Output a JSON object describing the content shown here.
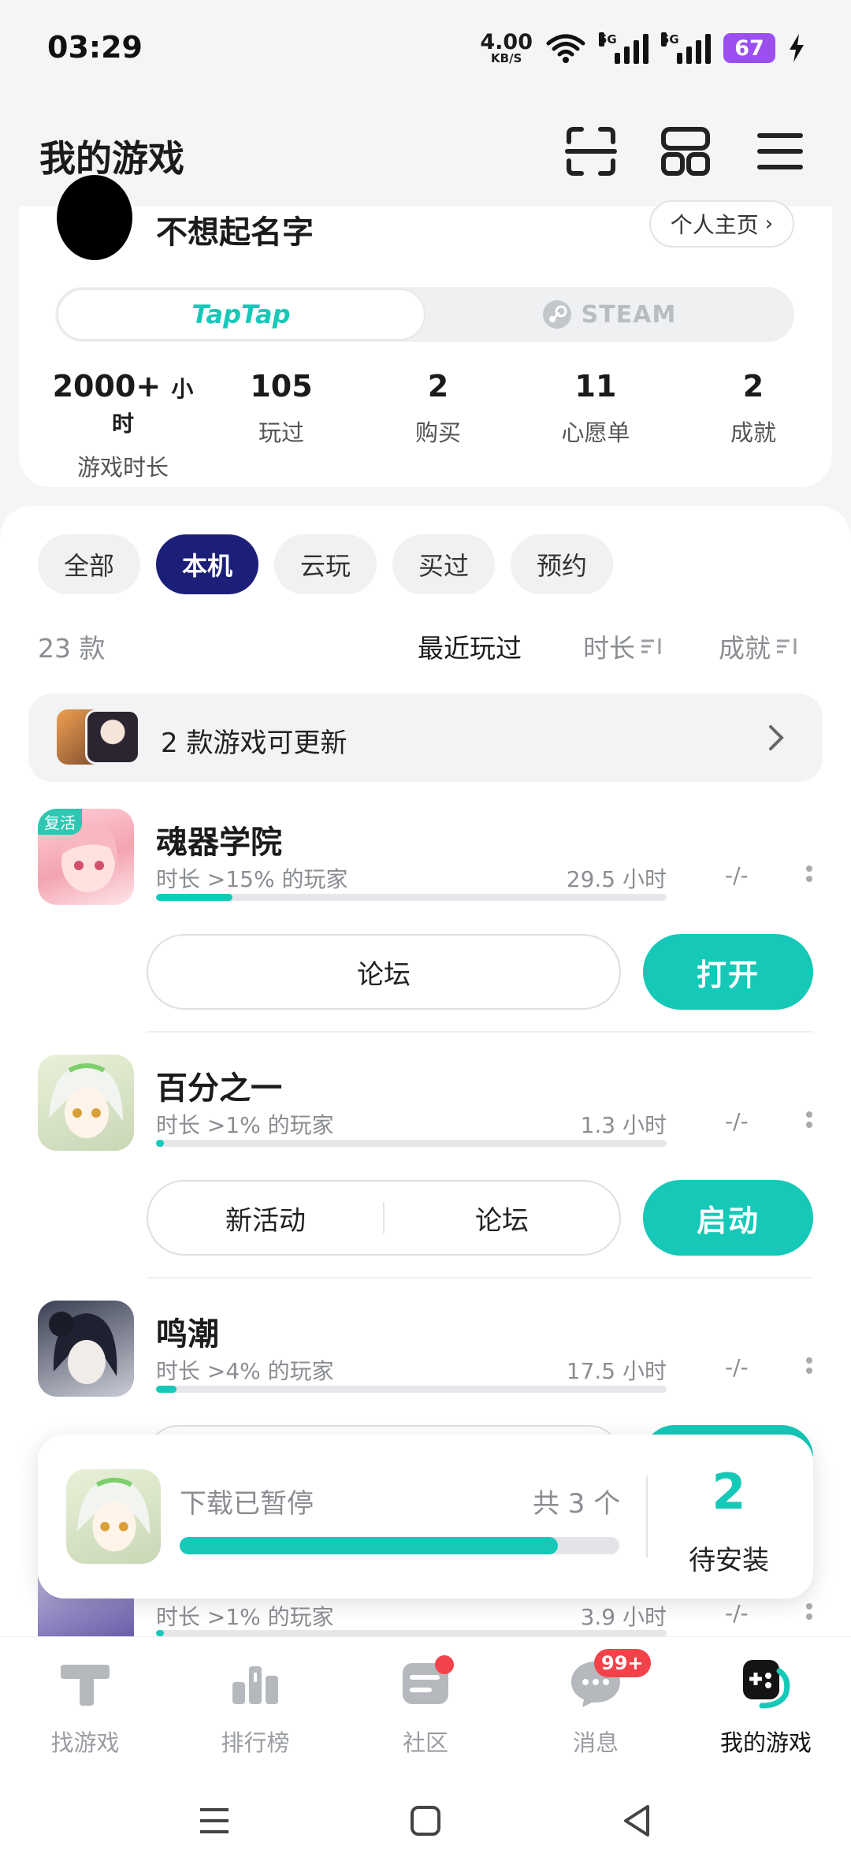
{
  "status_bar": {
    "time": "03:29",
    "net_speed": "4.00",
    "net_unit": "KB/S",
    "sim1": "5G",
    "sim2": "5G",
    "battery": "67"
  },
  "header": {
    "title": "我的游戏"
  },
  "profile": {
    "username": "不想起名字",
    "home_link": "个人主页",
    "platforms": [
      "TapTap",
      "STEAM"
    ],
    "stats": [
      {
        "value": "2000+",
        "unit": "小时",
        "label": "游戏时长"
      },
      {
        "value": "105",
        "unit": "",
        "label": "玩过"
      },
      {
        "value": "2",
        "unit": "",
        "label": "购买"
      },
      {
        "value": "11",
        "unit": "",
        "label": "心愿单"
      },
      {
        "value": "2",
        "unit": "",
        "label": "成就"
      }
    ]
  },
  "filters": [
    "全部",
    "本机",
    "云玩",
    "买过",
    "预约"
  ],
  "active_filter": "本机",
  "list": {
    "count": "23 款",
    "sort_options": [
      "最近玩过",
      "时长",
      "成就"
    ],
    "update_banner": "2 款游戏可更新"
  },
  "games": [
    {
      "name": "魂器学院",
      "percentile": "时长 >15% 的玩家",
      "hours": "29.5 小时",
      "achievement": "-/-",
      "progress": 0.15,
      "buttons": [
        "论坛"
      ],
      "primary": "打开",
      "badge": "复活"
    },
    {
      "name": "百分之一",
      "percentile": "时长 >1% 的玩家",
      "hours": "1.3 小时",
      "achievement": "-/-",
      "progress": 0.01,
      "buttons": [
        "新活动",
        "论坛"
      ],
      "primary": "启动"
    },
    {
      "name": "鸣潮",
      "percentile": "时长 >4% 的玩家",
      "hours": "17.5 小时",
      "achievement": "-/-",
      "progress": 0.04
    },
    {
      "name": "",
      "percentile": "时长 >1% 的玩家",
      "hours": "3.9 小时",
      "achievement": "-/-",
      "progress": 0.01
    }
  ],
  "download": {
    "status": "下载已暂停",
    "total": "共 3 个",
    "progress": 0.86,
    "pending_count": "2",
    "pending_label": "待安装"
  },
  "bottom_nav": [
    {
      "label": "找游戏"
    },
    {
      "label": "排行榜"
    },
    {
      "label": "社区"
    },
    {
      "label": "消息",
      "badge": "99+"
    },
    {
      "label": "我的游戏"
    }
  ],
  "colors": {
    "accent": "#16c8b8",
    "chip_active": "#1c1f78",
    "badge": "#f2424a",
    "battery": "#9b4ff0"
  }
}
